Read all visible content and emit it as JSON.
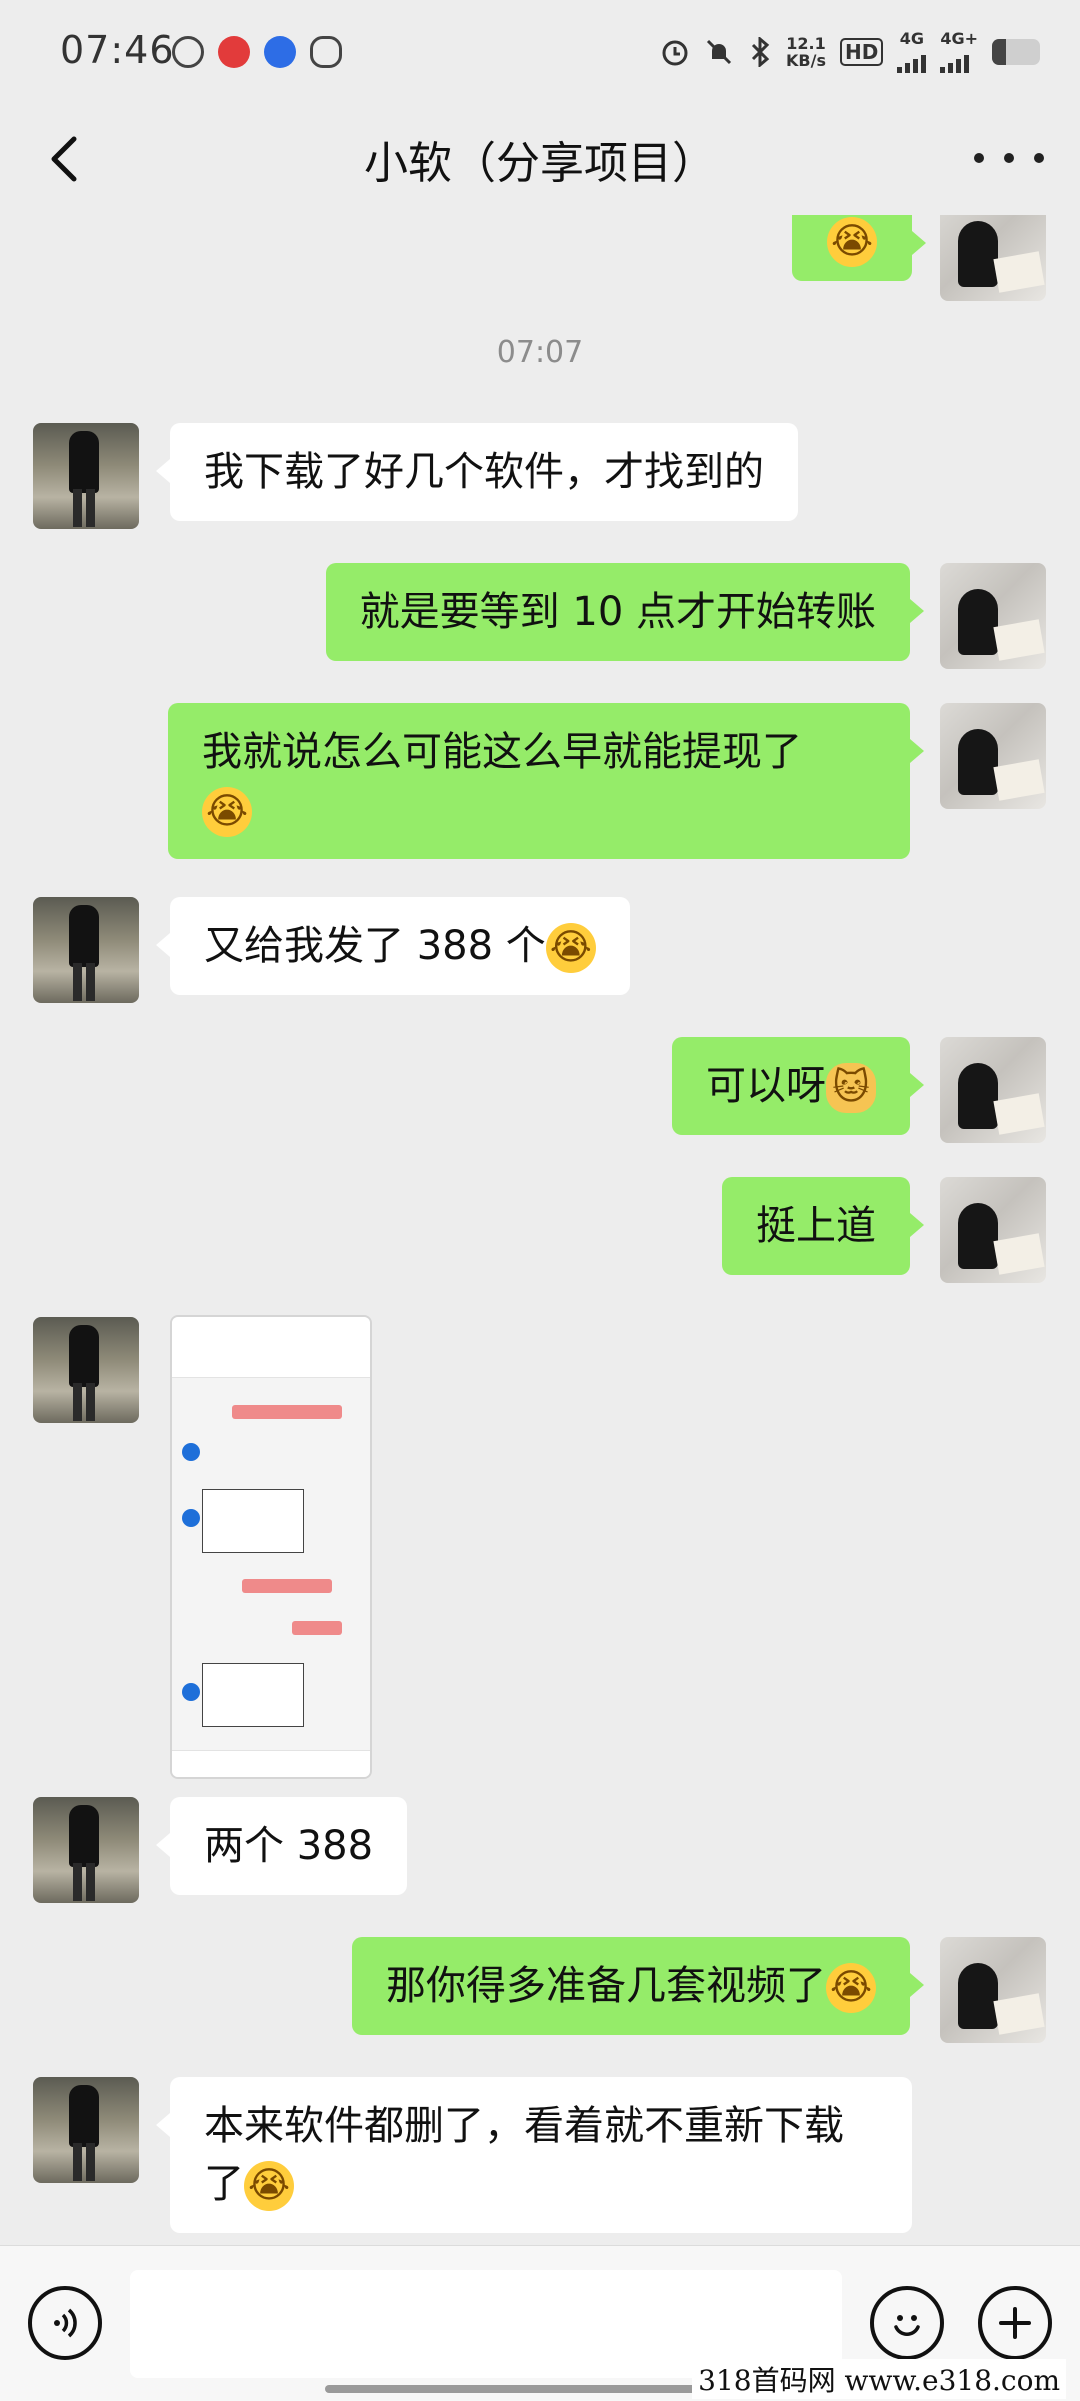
{
  "status_bar": {
    "time": "07:46",
    "net_speed_value": "12.1",
    "net_speed_unit": "KB/s",
    "hd_label": "HD",
    "net1": "4G",
    "net2": "4G+",
    "battery_level": 0.3
  },
  "header": {
    "title": "小软（分享项目）"
  },
  "timestamp": "07:07",
  "messages": [
    {
      "side": "right",
      "text": ""
    },
    {
      "side": "left",
      "text": "我下载了好几个软件，才找到的"
    },
    {
      "side": "right",
      "text": "就是要等到 10 点才开始转账"
    },
    {
      "side": "right",
      "text": "我就说怎么可能这么早就能提现了"
    },
    {
      "side": "left",
      "text": "又给我发了 388 个"
    },
    {
      "side": "right",
      "text": "可以呀"
    },
    {
      "side": "right",
      "text": "挺上道"
    },
    {
      "side": "left",
      "type": "image"
    },
    {
      "side": "left",
      "text": "两个 388"
    },
    {
      "side": "right",
      "text": "那你得多准备几套视频了"
    },
    {
      "side": "left",
      "text": "本来软件都删了，看着就不重新下载了"
    }
  ],
  "emoji": {
    "laugh_cry": "😭",
    "cat": "🐱"
  },
  "watermark": "318首码网 www.e318.com",
  "icons": {
    "back": "chevron-left-icon",
    "more": "more-dots-icon",
    "voice": "voice-icon",
    "emoji": "emoji-icon",
    "plus": "plus-icon"
  },
  "colors": {
    "bubble_right": "#95ec69",
    "bubble_left": "#ffffff",
    "background": "#ededed"
  }
}
